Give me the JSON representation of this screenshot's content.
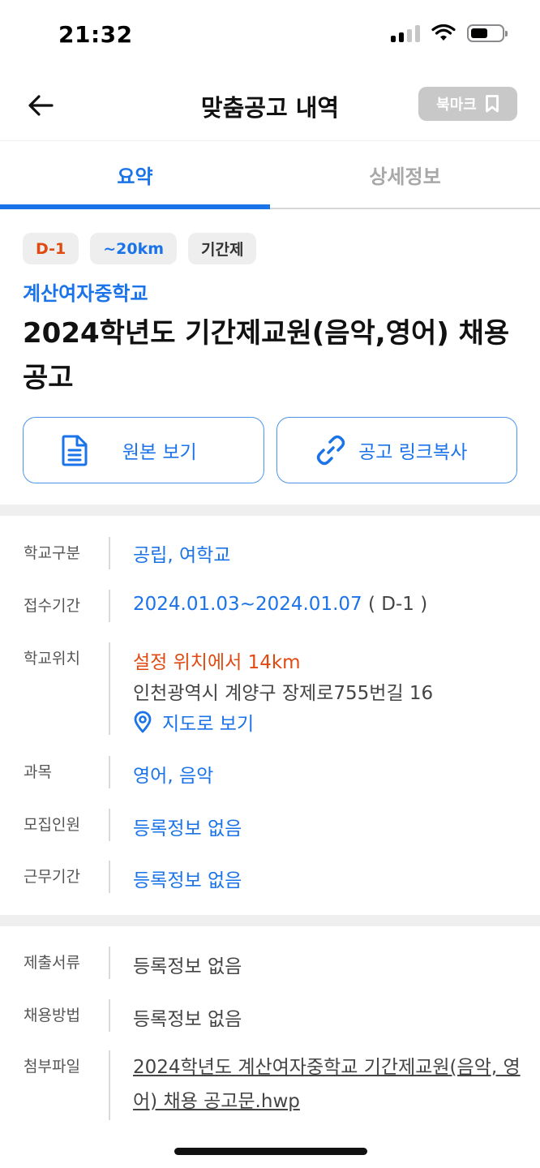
{
  "status": {
    "time": "21:32"
  },
  "header": {
    "title": "맞춤공고 내역",
    "bookmark_label": "북마크"
  },
  "tabs": [
    {
      "label": "요약",
      "active": true
    },
    {
      "label": "상세정보",
      "active": false
    }
  ],
  "tags": {
    "dday": "D-1",
    "distance": "~20km",
    "type": "기간제"
  },
  "school": {
    "name": "계산여자중학교"
  },
  "post": {
    "title": "2024학년도 기간제교원(음악,영어) 채용 공고"
  },
  "actions": {
    "original_label": "원본 보기",
    "copy_link_label": "공고 링크복사"
  },
  "info": {
    "school_type": {
      "label": "학교구분",
      "value": "공립, 여학교"
    },
    "period": {
      "label": "접수기간",
      "value": "2024.01.03~2024.01.07",
      "dday": "( D-1 )"
    },
    "location": {
      "label": "학교위치",
      "distance_text": "설정 위치에서 14km",
      "address": "인천광역시 계양구 장제로755번길 16",
      "map_label": "지도로 보기"
    },
    "subject": {
      "label": "과목",
      "value": "영어, 음악"
    },
    "recruits": {
      "label": "모집인원",
      "value": "등록정보 없음"
    },
    "work_period": {
      "label": "근무기간",
      "value": "등록정보 없음"
    }
  },
  "extra": {
    "documents": {
      "label": "제출서류",
      "value": "등록정보 없음"
    },
    "method": {
      "label": "채용방법",
      "value": "등록정보 없음"
    },
    "attachment": {
      "label": "첨부파일",
      "value": "2024학년도 계산여자중학교 기간제교원(음악, 영어) 채용 공고문.hwp"
    }
  },
  "colors": {
    "accent": "#1a73e8",
    "warning": "#e04a12",
    "bookmark_bg": "#c8c8c8"
  }
}
